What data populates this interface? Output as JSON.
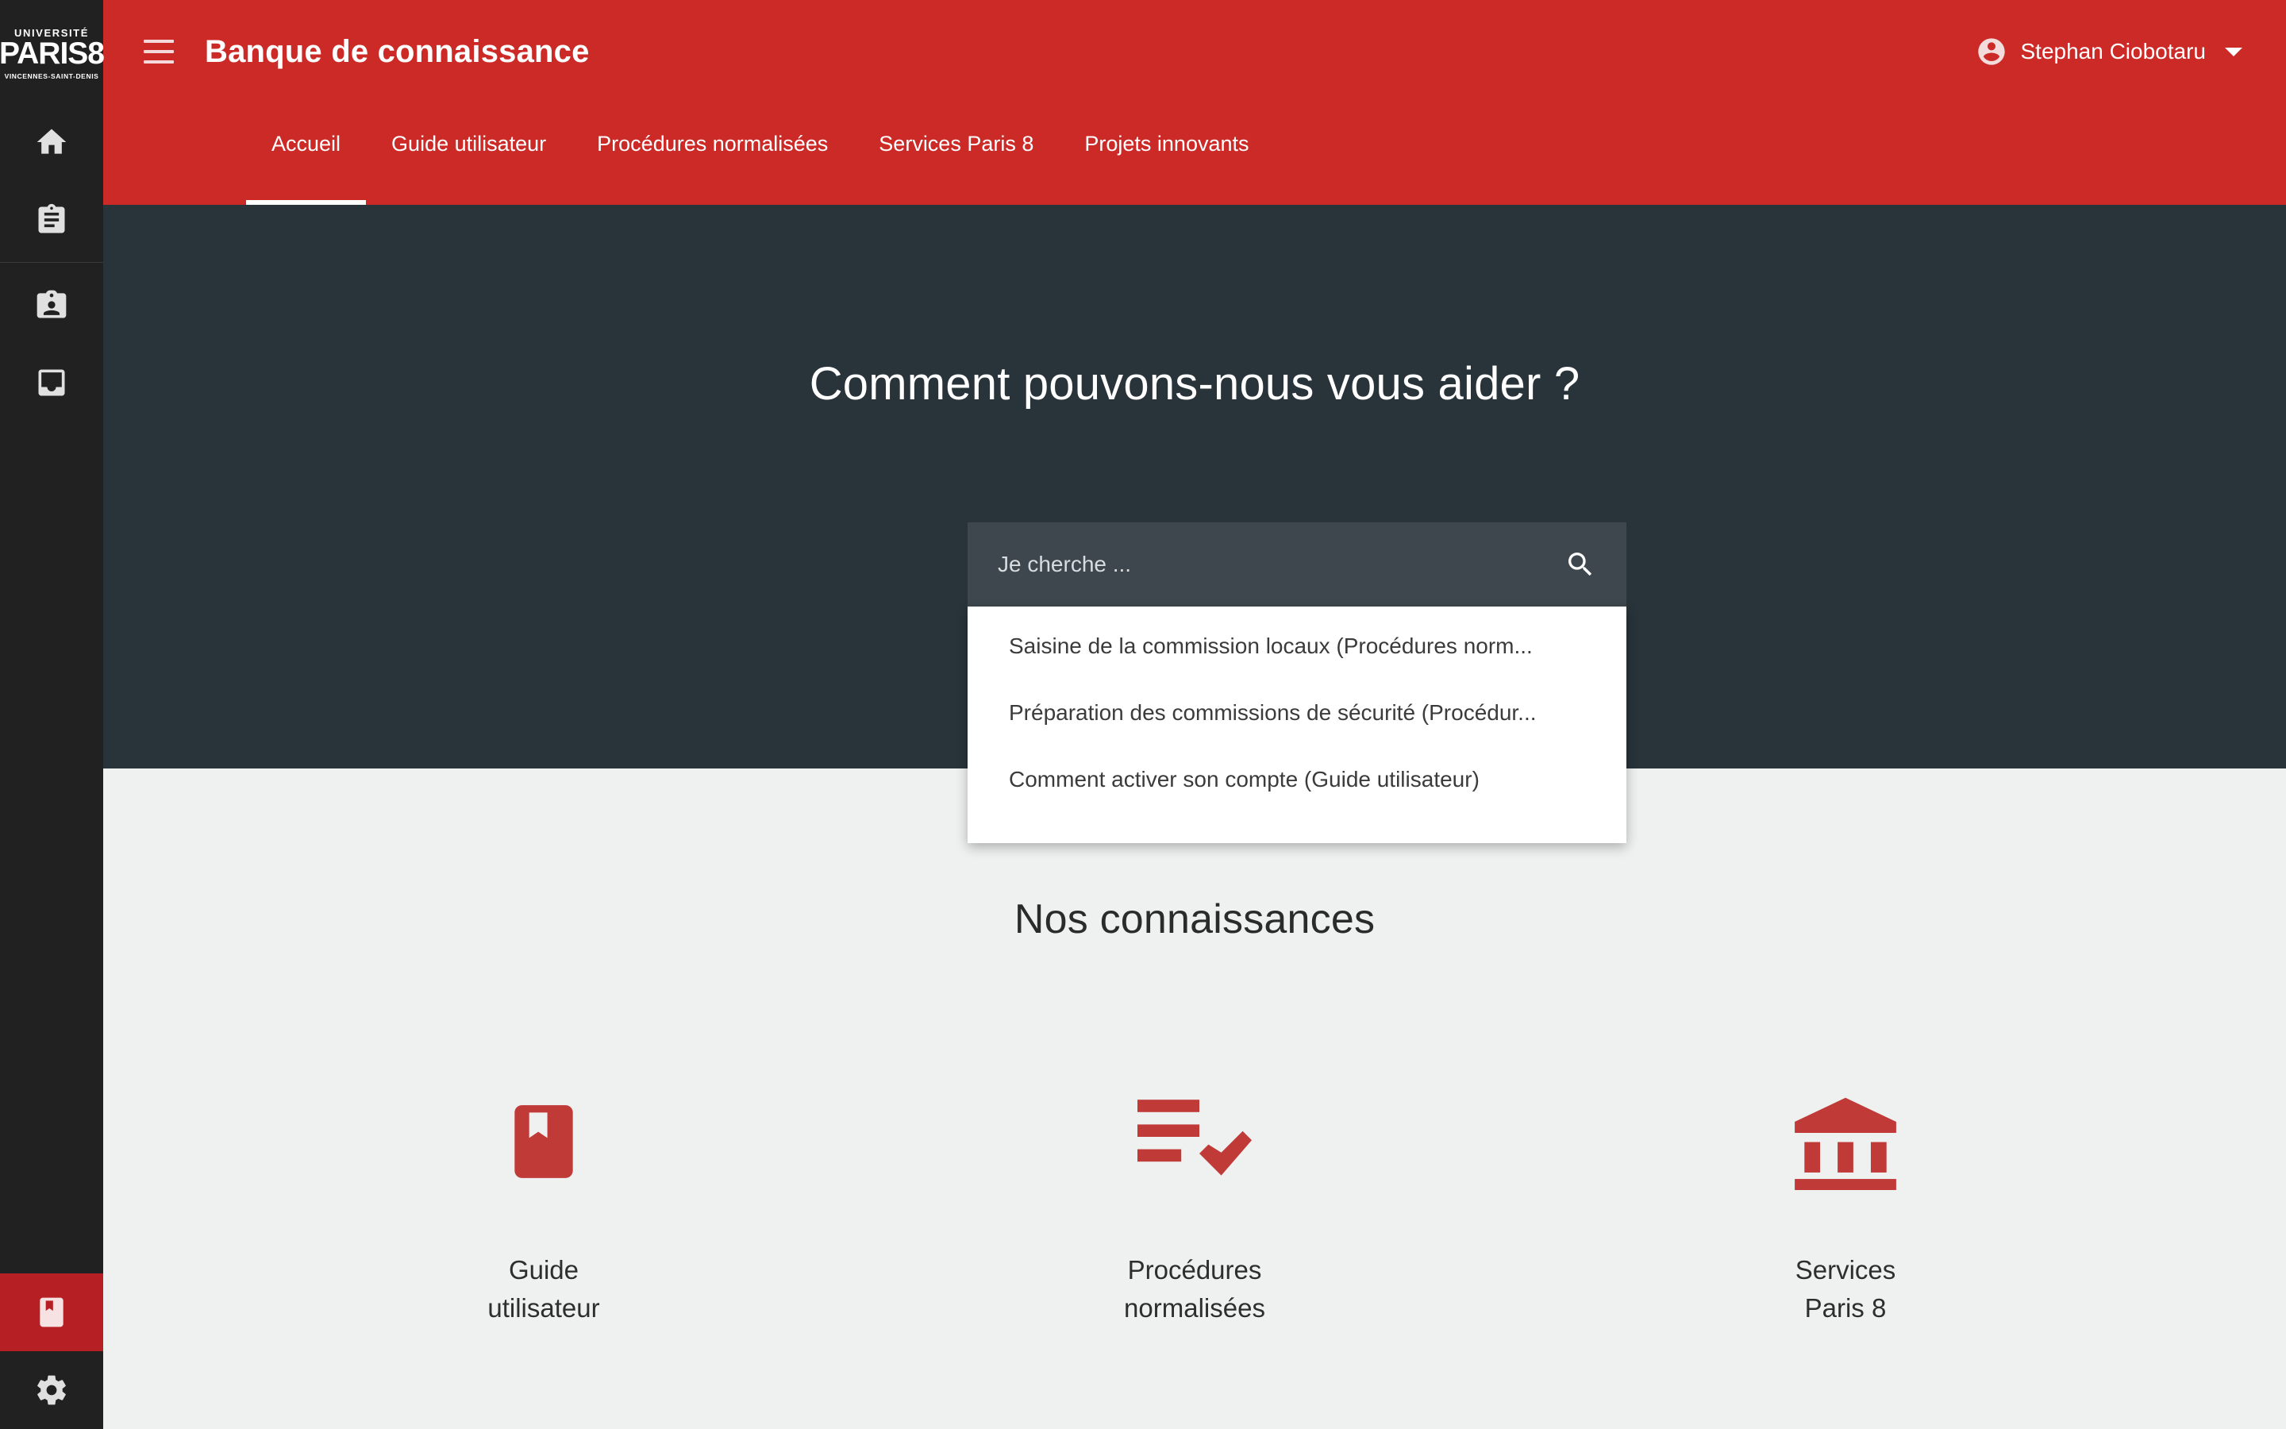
{
  "colors": {
    "brand_red": "#cc2a27",
    "rail_dark": "#212121",
    "hero_dark": "#28333a",
    "content_bg": "#eff0f0",
    "icon_red": "#c03a38",
    "active_rail_red": "#b62025"
  },
  "logo": {
    "line1": "UNIVERSITÉ",
    "line2": "PARIS8",
    "line3": "VINCENNES-SAINT-DENIS"
  },
  "rail": {
    "items": [
      {
        "icon": "home-icon",
        "name": "rail-item-home"
      },
      {
        "icon": "assignment-icon",
        "name": "rail-item-assignment"
      },
      {
        "icon": "badge-icon",
        "name": "rail-item-badge"
      },
      {
        "icon": "inbox-icon",
        "name": "rail-item-inbox"
      }
    ],
    "bottom_items": [
      {
        "icon": "book-bookmark-icon",
        "name": "rail-item-knowledge",
        "active": true
      },
      {
        "icon": "gear-icon",
        "name": "rail-item-settings",
        "active": false
      }
    ]
  },
  "header": {
    "menu_icon": "hamburger-icon",
    "title": "Banque de connaissance",
    "user": {
      "avatar_icon": "account-circle-icon",
      "name": "Stephan Ciobotaru",
      "caret_icon": "chevron-down-icon"
    }
  },
  "nav": {
    "tabs": [
      {
        "label": "Accueil",
        "active": true
      },
      {
        "label": "Guide utilisateur",
        "active": false
      },
      {
        "label": "Procédures normalisées",
        "active": false
      },
      {
        "label": "Services Paris 8",
        "active": false
      },
      {
        "label": "Projets innovants",
        "active": false
      }
    ]
  },
  "hero": {
    "title": "Comment pouvons-nous vous aider ?",
    "search": {
      "placeholder": "Je cherche ...",
      "value": "",
      "icon": "search-icon",
      "suggestions": [
        "Saisine de la commission locaux (Procédures norm...",
        "Préparation des commissions de sécurité (Procédur...",
        "Comment activer son compte (Guide utilisateur)"
      ]
    }
  },
  "content": {
    "title": "Nos connaissances",
    "cards": [
      {
        "icon": "book-bookmark-icon",
        "label": "Guide\nutilisateur"
      },
      {
        "icon": "playlist-check-icon",
        "label": "Procédures\nnormalisées"
      },
      {
        "icon": "account-balance-icon",
        "label": "Services\nParis 8"
      }
    ]
  }
}
